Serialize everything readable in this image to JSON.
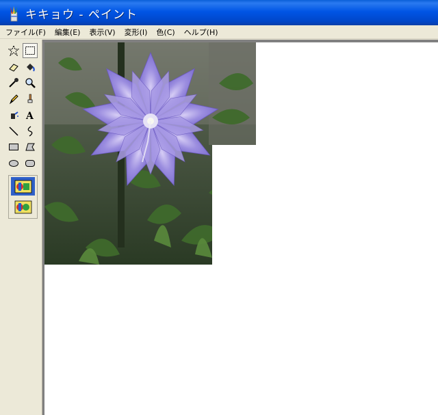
{
  "window": {
    "title": "キキョウ - ペイント",
    "app_icon": "paint-icon"
  },
  "menu": {
    "items": [
      "ファイル(F)",
      "編集(E)",
      "表示(V)",
      "変形(I)",
      "色(C)",
      "ヘルプ(H)"
    ]
  },
  "toolbox": {
    "tools": [
      "free-form-select-icon",
      "rectangle-select-icon",
      "eraser-icon",
      "fill-bucket-icon",
      "color-picker-icon",
      "magnifier-icon",
      "pencil-icon",
      "brush-icon",
      "airbrush-icon",
      "text-icon",
      "line-icon",
      "curve-icon",
      "rectangle-icon",
      "polygon-icon",
      "ellipse-icon",
      "rounded-rectangle-icon"
    ],
    "selected_tool": "rectangle-select-icon",
    "options": [
      "opaque-selection-icon",
      "transparent-selection-icon"
    ]
  },
  "canvas": {
    "image": "balloon-flower-photo",
    "colors": {
      "petal": "#8a7ad8",
      "background": "#ffffff"
    }
  }
}
